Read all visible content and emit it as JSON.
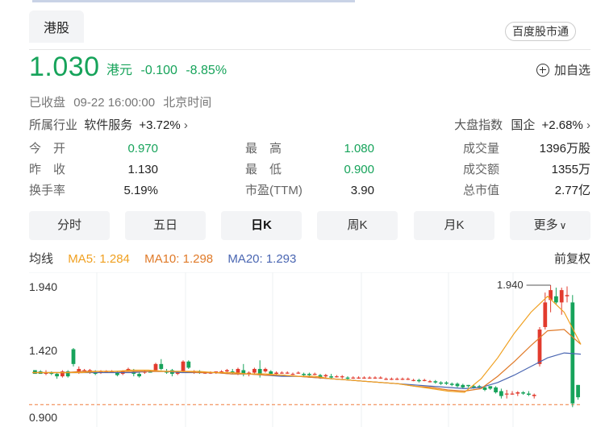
{
  "header": {
    "market_tab": "港股",
    "baidu_button": "百度股市通"
  },
  "quote": {
    "price": "1.030",
    "currency": "港元",
    "change": "-0.100",
    "change_pct": "-8.85%",
    "add_watchlist": "加自选",
    "status": "已收盘",
    "datetime": "09-22 16:00:00",
    "timezone": "北京时间",
    "industry_label": "所属行业",
    "industry_name": "软件服务",
    "industry_change": "+3.72%",
    "index_label": "大盘指数",
    "index_name": "国企",
    "index_change": "+2.68%"
  },
  "stats": {
    "open_label": "今　开",
    "open": "0.970",
    "prev_close_label": "昨　收",
    "prev_close": "1.130",
    "turnover_label": "换手率",
    "turnover": "5.19%",
    "high_label": "最　高",
    "high": "1.080",
    "low_label": "最　低",
    "low": "0.900",
    "pe_label": "市盈(TTM)",
    "pe": "3.90",
    "volume_label": "成交量",
    "volume": "1396万股",
    "amount_label": "成交额",
    "amount": "1355万",
    "mktcap_label": "总市值",
    "mktcap": "2.77亿"
  },
  "tabs": [
    "分时",
    "五日",
    "日K",
    "周K",
    "月K",
    "更多"
  ],
  "active_tab": "日K",
  "ma": {
    "label": "均线",
    "ma5": "MA5: 1.284",
    "ma10": "MA10: 1.298",
    "ma20": "MA20: 1.293",
    "adjust": "前复权"
  },
  "chart_data": {
    "type": "candlestick",
    "y_ticks": [
      "1.940",
      "1.420",
      "0.900"
    ],
    "max_label": "1.940",
    "ref_line": 0.97,
    "colors": {
      "up": "#e23b2e",
      "down": "#17a35b",
      "ma5": "#f0a020",
      "ma10": "#e07a28",
      "ma20": "#4a66b2",
      "ref": "#f07a3a"
    },
    "candles": [
      [
        1.25,
        1.25,
        1.23,
        1.22
      ],
      [
        1.24,
        1.25,
        1.23,
        1.22
      ],
      [
        1.22,
        1.25,
        1.21,
        1.23
      ],
      [
        1.23,
        1.24,
        1.21,
        1.22
      ],
      [
        1.22,
        1.23,
        1.18,
        1.2
      ],
      [
        1.2,
        1.25,
        1.19,
        1.24
      ],
      [
        1.24,
        1.25,
        1.19,
        1.2
      ],
      [
        1.42,
        1.43,
        1.28,
        1.3
      ],
      [
        1.24,
        1.28,
        1.22,
        1.26
      ],
      [
        1.25,
        1.26,
        1.24,
        1.25
      ],
      [
        1.24,
        1.26,
        1.22,
        1.25
      ],
      [
        1.23,
        1.25,
        1.21,
        1.22
      ],
      [
        1.24,
        1.25,
        1.22,
        1.24
      ],
      [
        1.24,
        1.25,
        1.23,
        1.24
      ],
      [
        1.24,
        1.25,
        1.23,
        1.24
      ],
      [
        1.23,
        1.24,
        1.2,
        1.21
      ],
      [
        1.22,
        1.25,
        1.21,
        1.24
      ],
      [
        1.25,
        1.27,
        1.24,
        1.26
      ],
      [
        1.24,
        1.26,
        1.2,
        1.22
      ],
      [
        1.22,
        1.23,
        1.19,
        1.2
      ],
      [
        1.23,
        1.25,
        1.22,
        1.24
      ],
      [
        1.24,
        1.25,
        1.23,
        1.23
      ],
      [
        1.25,
        1.31,
        1.24,
        1.3
      ],
      [
        1.3,
        1.34,
        1.25,
        1.26
      ],
      [
        1.24,
        1.26,
        1.22,
        1.23
      ],
      [
        1.25,
        1.26,
        1.2,
        1.22
      ],
      [
        1.22,
        1.24,
        1.21,
        1.23
      ],
      [
        1.24,
        1.33,
        1.23,
        1.32
      ],
      [
        1.32,
        1.33,
        1.26,
        1.27
      ],
      [
        1.24,
        1.25,
        1.22,
        1.24
      ],
      [
        1.24,
        1.25,
        1.22,
        1.23
      ],
      [
        1.23,
        1.24,
        1.22,
        1.23
      ],
      [
        1.23,
        1.24,
        1.22,
        1.23
      ],
      [
        1.23,
        1.24,
        1.22,
        1.24
      ],
      [
        1.24,
        1.25,
        1.23,
        1.24
      ],
      [
        1.24,
        1.26,
        1.22,
        1.25
      ],
      [
        1.24,
        1.26,
        1.22,
        1.23
      ],
      [
        1.23,
        1.27,
        1.21,
        1.26
      ],
      [
        1.25,
        1.3,
        1.2,
        1.22
      ],
      [
        1.22,
        1.24,
        1.2,
        1.23
      ],
      [
        1.23,
        1.27,
        1.22,
        1.26
      ],
      [
        1.26,
        1.33,
        1.19,
        1.22
      ],
      [
        1.24,
        1.27,
        1.23,
        1.26
      ],
      [
        1.24,
        1.25,
        1.22,
        1.22
      ],
      [
        1.22,
        1.24,
        1.21,
        1.23
      ],
      [
        1.23,
        1.24,
        1.22,
        1.23
      ],
      [
        1.23,
        1.24,
        1.22,
        1.23
      ],
      [
        1.22,
        1.23,
        1.21,
        1.22
      ],
      [
        1.23,
        1.24,
        1.22,
        1.23
      ],
      [
        1.22,
        1.23,
        1.2,
        1.21
      ],
      [
        1.22,
        1.23,
        1.2,
        1.21
      ],
      [
        1.22,
        1.23,
        1.21,
        1.22
      ],
      [
        1.21,
        1.22,
        1.18,
        1.19
      ],
      [
        1.2,
        1.22,
        1.19,
        1.21
      ],
      [
        1.2,
        1.22,
        1.18,
        1.19
      ],
      [
        1.2,
        1.21,
        1.19,
        1.2
      ],
      [
        1.2,
        1.21,
        1.18,
        1.2
      ],
      [
        1.19,
        1.2,
        1.17,
        1.18
      ],
      [
        1.19,
        1.2,
        1.18,
        1.19
      ],
      [
        1.19,
        1.2,
        1.18,
        1.19
      ],
      [
        1.19,
        1.2,
        1.18,
        1.19
      ],
      [
        1.19,
        1.2,
        1.18,
        1.19
      ],
      [
        1.19,
        1.2,
        1.18,
        1.19
      ],
      [
        1.19,
        1.2,
        1.18,
        1.19
      ],
      [
        1.18,
        1.19,
        1.17,
        1.18
      ],
      [
        1.18,
        1.19,
        1.17,
        1.18
      ],
      [
        1.18,
        1.19,
        1.17,
        1.18
      ],
      [
        1.18,
        1.19,
        1.17,
        1.18
      ],
      [
        1.18,
        1.19,
        1.17,
        1.18
      ],
      [
        1.17,
        1.18,
        1.16,
        1.17
      ],
      [
        1.17,
        1.18,
        1.15,
        1.16
      ],
      [
        1.17,
        1.18,
        1.16,
        1.17
      ],
      [
        1.16,
        1.17,
        1.15,
        1.16
      ],
      [
        1.16,
        1.17,
        1.14,
        1.15
      ],
      [
        1.15,
        1.16,
        1.13,
        1.14
      ],
      [
        1.15,
        1.16,
        1.13,
        1.14
      ],
      [
        1.14,
        1.15,
        1.12,
        1.13
      ],
      [
        1.14,
        1.15,
        1.11,
        1.12
      ],
      [
        1.13,
        1.14,
        1.1,
        1.11
      ],
      [
        1.13,
        1.13,
        1.11,
        1.12
      ],
      [
        1.12,
        1.13,
        1.1,
        1.11
      ],
      [
        1.12,
        1.13,
        1.1,
        1.11
      ],
      [
        1.11,
        1.12,
        1.08,
        1.09
      ],
      [
        1.12,
        1.12,
        1.09,
        1.1
      ],
      [
        1.11,
        1.12,
        1.06,
        1.07
      ],
      [
        1.08,
        1.1,
        1.02,
        1.04
      ],
      [
        1.06,
        1.09,
        1.02,
        1.06
      ],
      [
        1.06,
        1.08,
        1.05,
        1.06
      ],
      [
        1.06,
        1.08,
        1.04,
        1.07
      ],
      [
        1.07,
        1.08,
        1.05,
        1.06
      ],
      [
        1.06,
        1.08,
        1.04,
        1.05
      ],
      [
        1.04,
        1.06,
        1.02,
        1.05
      ],
      [
        1.3,
        1.6,
        1.28,
        1.58
      ],
      [
        1.6,
        1.88,
        1.58,
        1.8
      ],
      [
        1.82,
        1.94,
        1.72,
        1.9
      ],
      [
        1.85,
        1.92,
        1.78,
        1.8
      ],
      [
        1.8,
        1.92,
        1.7,
        1.9
      ],
      [
        1.85,
        1.93,
        1.8,
        1.86
      ],
      [
        1.8,
        1.86,
        0.95,
        0.98
      ],
      [
        1.13,
        1.13,
        1.01,
        1.03
      ]
    ],
    "ma_lines": {
      "ma5": [
        1.23,
        1.23,
        1.23,
        1.23,
        1.24,
        1.24,
        1.25,
        1.25,
        1.24,
        1.24,
        1.24,
        1.23,
        1.23,
        1.22,
        1.22,
        1.21,
        1.2,
        1.2,
        1.18,
        1.17,
        1.16,
        1.15,
        1.14,
        1.12,
        1.1,
        1.08,
        1.07,
        1.18,
        1.35,
        1.55,
        1.72,
        1.85,
        1.72,
        1.46
      ],
      "ma10": [
        1.23,
        1.23,
        1.23,
        1.24,
        1.24,
        1.24,
        1.24,
        1.24,
        1.24,
        1.24,
        1.23,
        1.23,
        1.22,
        1.22,
        1.21,
        1.21,
        1.2,
        1.19,
        1.18,
        1.17,
        1.16,
        1.15,
        1.14,
        1.12,
        1.11,
        1.09,
        1.08,
        1.1,
        1.2,
        1.32,
        1.45,
        1.57,
        1.58,
        1.46
      ],
      "ma20": [
        1.23,
        1.23,
        1.23,
        1.23,
        1.23,
        1.23,
        1.23,
        1.24,
        1.24,
        1.23,
        1.23,
        1.23,
        1.22,
        1.22,
        1.21,
        1.2,
        1.2,
        1.19,
        1.18,
        1.17,
        1.16,
        1.15,
        1.14,
        1.13,
        1.12,
        1.11,
        1.1,
        1.11,
        1.15,
        1.21,
        1.28,
        1.35,
        1.39,
        1.38
      ]
    }
  }
}
